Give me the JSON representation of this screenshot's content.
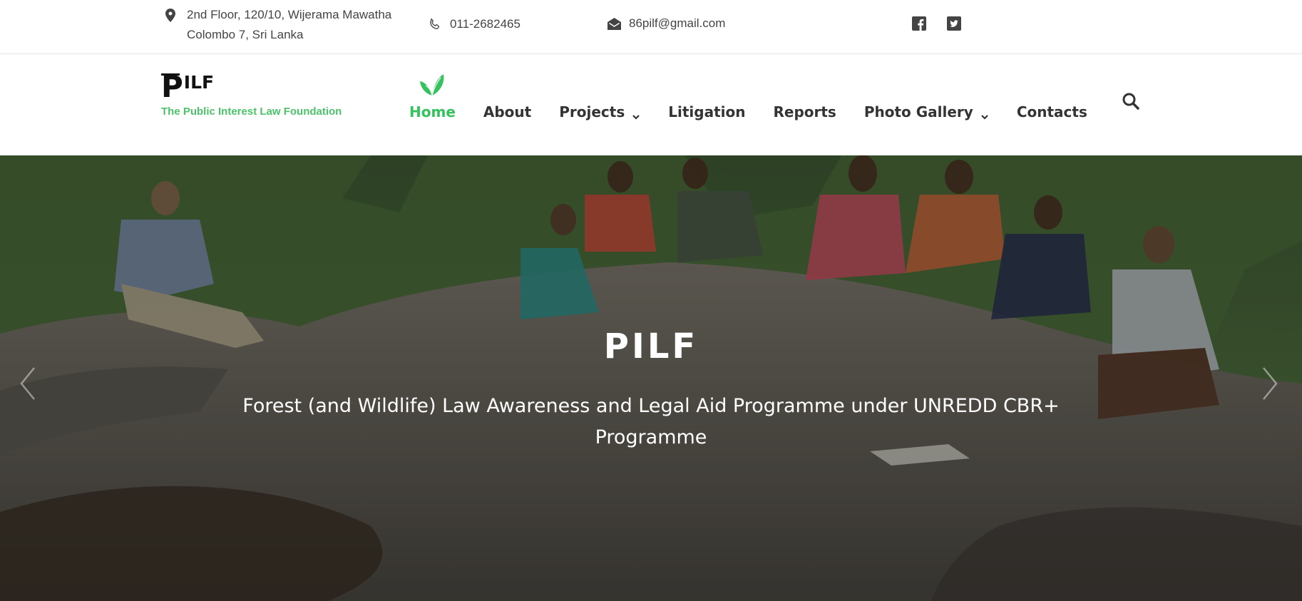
{
  "topbar": {
    "address_line1": "2nd Floor, 120/10, Wijerama Mawatha",
    "address_line2": "Colombo 7, Sri Lanka",
    "phone": "011-2682465",
    "email": "86pilf@gmail.com",
    "icons": {
      "address": "map-pin-icon",
      "phone": "phone-icon",
      "email": "envelope-icon",
      "facebook": "facebook-icon",
      "twitter": "twitter-icon"
    }
  },
  "logo": {
    "mark_p": "P",
    "mark_rest": "ILF",
    "tagline": "The Public Interest Law Foundation"
  },
  "nav": {
    "items": [
      {
        "label": "Home",
        "active": true
      },
      {
        "label": "About"
      },
      {
        "label": "Projects",
        "dropdown": true
      },
      {
        "label": "Litigation"
      },
      {
        "label": "Reports"
      },
      {
        "label": "Photo Gallery",
        "dropdown": true
      },
      {
        "label": "Contacts"
      }
    ],
    "active_icon": "leaf-icon",
    "search_icon": "search-icon"
  },
  "hero": {
    "title": "PILF",
    "subtitle": "Forest (and Wildlife) Law Awareness and Legal Aid Programme under UNREDD CBR+ Programme",
    "prev_icon": "chevron-left-icon",
    "next_icon": "chevron-right-icon"
  },
  "colors": {
    "accent": "#33c25b",
    "tagline": "#4cc36a",
    "nav_text": "#333333",
    "topbar_text": "#444444"
  }
}
